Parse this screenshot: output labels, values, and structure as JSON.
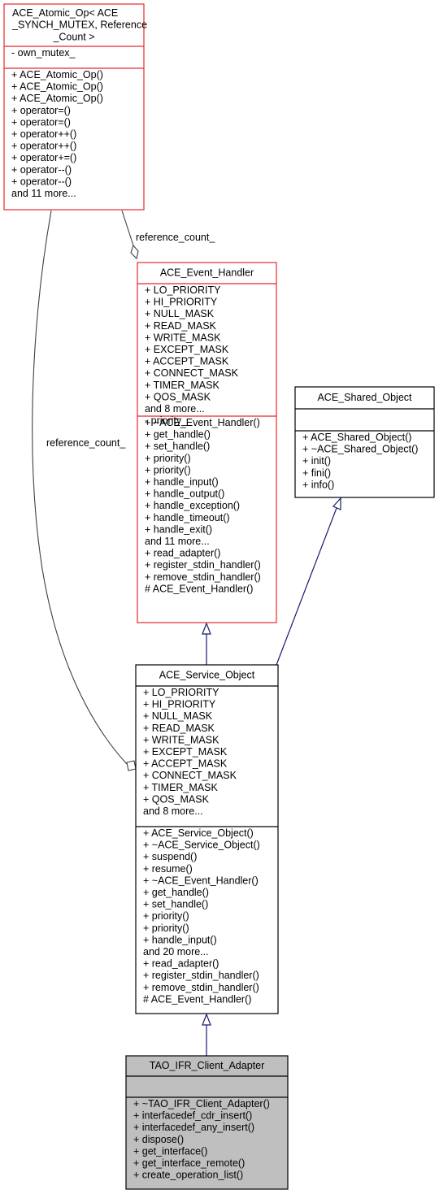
{
  "diagram": {
    "type": "uml-class-inheritance",
    "classes": [
      {
        "id": "atomic_op",
        "title_lines": [
          "ACE_Atomic_Op< ACE",
          "_SYNCH_MUTEX, Reference",
          "_Count >"
        ],
        "attributes": [
          "- own_mutex_"
        ],
        "operations": [
          "+ ACE_Atomic_Op()",
          "+ ACE_Atomic_Op()",
          "+ ACE_Atomic_Op()",
          "+ operator=()",
          "+ operator=()",
          "+ operator++()",
          "+ operator++()",
          "+ operator+=()",
          "+ operator--()",
          "+ operator--()",
          "and 11 more..."
        ],
        "border_color": "#e8282d"
      },
      {
        "id": "event_handler",
        "title_lines": [
          "ACE_Event_Handler"
        ],
        "attributes": [
          "+ LO_PRIORITY",
          "+ HI_PRIORITY",
          "+ NULL_MASK",
          "+ READ_MASK",
          "+ WRITE_MASK",
          "+ EXCEPT_MASK",
          "+ ACCEPT_MASK",
          "+ CONNECT_MASK",
          "+ TIMER_MASK",
          "+ QOS_MASK",
          "and 8 more...",
          "- priority_"
        ],
        "operations": [
          "+ ~ACE_Event_Handler()",
          "+ get_handle()",
          "+ set_handle()",
          "+ priority()",
          "+ priority()",
          "+ handle_input()",
          "+ handle_output()",
          "+ handle_exception()",
          "+ handle_timeout()",
          "+ handle_exit()",
          "and 11 more...",
          "+ read_adapter()",
          "+ register_stdin_handler()",
          "+ remove_stdin_handler()",
          "# ACE_Event_Handler()"
        ],
        "border_color": "#e8282d"
      },
      {
        "id": "shared_object",
        "title_lines": [
          "ACE_Shared_Object"
        ],
        "attributes": [],
        "operations": [
          "+ ACE_Shared_Object()",
          "+ ~ACE_Shared_Object()",
          "+ init()",
          "+ fini()",
          "+ info()"
        ],
        "border_color": "#000000"
      },
      {
        "id": "service_object",
        "title_lines": [
          "ACE_Service_Object"
        ],
        "attributes": [
          "+ LO_PRIORITY",
          "+ HI_PRIORITY",
          "+ NULL_MASK",
          "+ READ_MASK",
          "+ WRITE_MASK",
          "+ EXCEPT_MASK",
          "+ ACCEPT_MASK",
          "+ CONNECT_MASK",
          "+ TIMER_MASK",
          "+ QOS_MASK",
          "and 8 more..."
        ],
        "operations": [
          "+ ACE_Service_Object()",
          "+ ~ACE_Service_Object()",
          "+ suspend()",
          "+ resume()",
          "+ ~ACE_Event_Handler()",
          "+ get_handle()",
          "+ set_handle()",
          "+ priority()",
          "+ priority()",
          "+ handle_input()",
          "and 20 more...",
          "+ read_adapter()",
          "+ register_stdin_handler()",
          "+ remove_stdin_handler()",
          "# ACE_Event_Handler()"
        ],
        "border_color": "#000000"
      },
      {
        "id": "ifr_client_adapter",
        "title_lines": [
          "TAO_IFR_Client_Adapter"
        ],
        "attributes": [],
        "operations": [
          "+ ~TAO_IFR_Client_Adapter()",
          "+ interfacedef_cdr_insert()",
          "+ interfacedef_any_insert()",
          "+ dispose()",
          "+ get_interface()",
          "+ get_interface_remote()",
          "+ create_operation_list()"
        ],
        "border_color": "#000000",
        "fill_color": "#bfbfbf",
        "highlighted": true
      }
    ],
    "edges": [
      {
        "id": "ref-count-to-event-handler",
        "kind": "aggregation",
        "from": "atomic_op",
        "to": "event_handler",
        "label": "reference_count_"
      },
      {
        "id": "ref-count-to-service-object",
        "kind": "aggregation",
        "from": "atomic_op",
        "to": "service_object",
        "label": "reference_count_"
      },
      {
        "id": "event-handler-to-service-object",
        "kind": "inheritance",
        "from": "service_object",
        "to": "event_handler"
      },
      {
        "id": "shared-object-to-service-object",
        "kind": "inheritance",
        "from": "service_object",
        "to": "shared_object"
      },
      {
        "id": "service-object-to-ifr-client-adapter",
        "kind": "inheritance",
        "from": "ifr_client_adapter",
        "to": "service_object"
      }
    ],
    "colors": {
      "highlight_border": "#e8282d",
      "inheritance_edge": "#191970",
      "aggregation_edge": "#404040",
      "focus_fill": "#bfbfbf"
    }
  }
}
